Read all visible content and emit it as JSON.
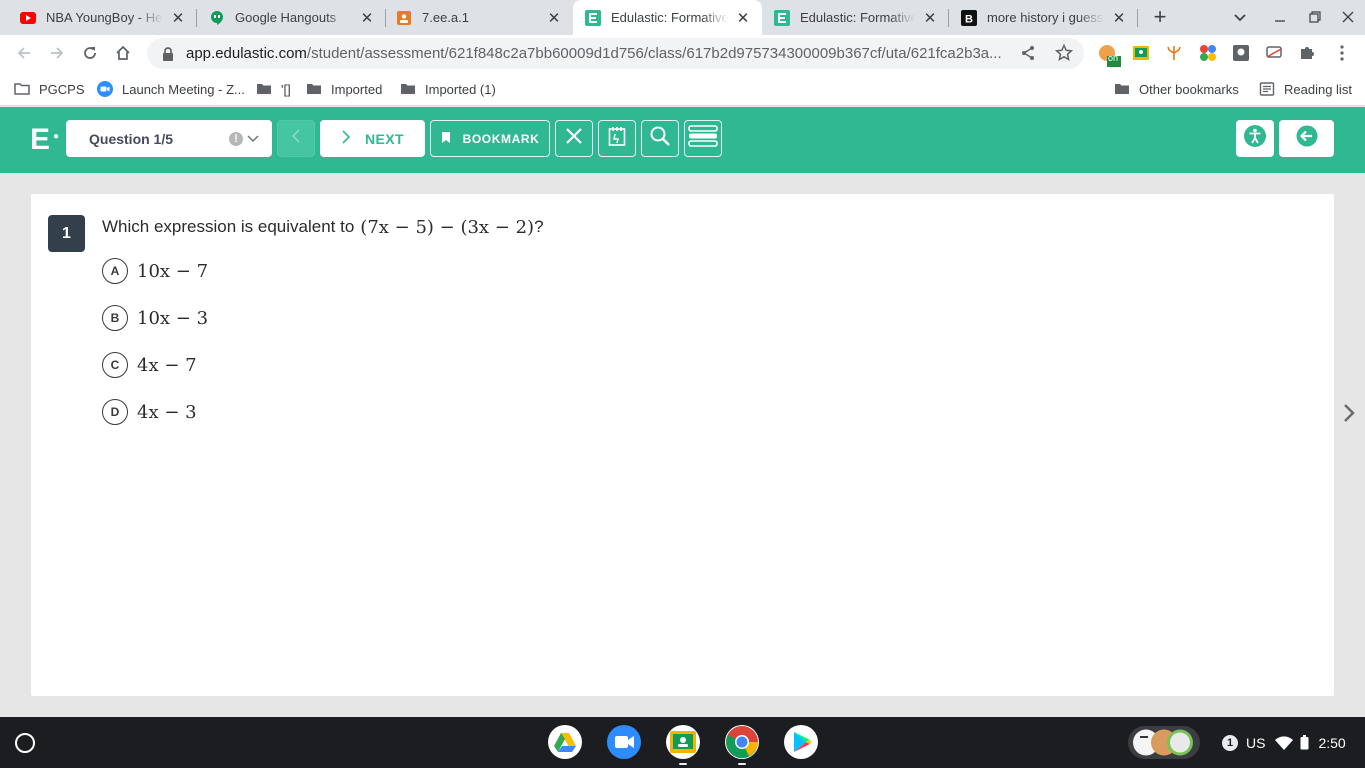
{
  "browser": {
    "tabs": [
      {
        "title": "NBA YoungBoy - Hear",
        "favicon": "youtube-icon",
        "active": false
      },
      {
        "title": "Google Hangouts",
        "favicon": "hangouts-icon",
        "active": false
      },
      {
        "title": "7.ee.a.1",
        "favicon": "slides-icon",
        "active": false
      },
      {
        "title": "Edulastic: Formative a",
        "favicon": "edulastic-icon",
        "active": true
      },
      {
        "title": "Edulastic: Formative a",
        "favicon": "edulastic-icon",
        "active": false
      },
      {
        "title": "more history i guess",
        "favicon": "brainly-icon",
        "active": false
      }
    ],
    "new_tab_symbol": "+",
    "address": {
      "host": "app.edulastic.com",
      "path": "/student/assessment/621f848c2a7bb60009d1d756/class/617b2d975734300009b367cf/uta/621fca2b3a..."
    },
    "extension_badge": "on",
    "bookmarks": [
      "PGCPS",
      "Launch Meeting - Z...",
      "'[]",
      "Imported",
      "Imported (1)"
    ],
    "other_bookmarks": "Other bookmarks",
    "reading_list": "Reading list"
  },
  "edulastic": {
    "logo": "E",
    "question_select": "Question 1/5",
    "warning_symbol": "!",
    "next_label": "NEXT",
    "bookmark_label": "BOOKMARK",
    "brand_color": "#2fb892"
  },
  "question": {
    "number": "1",
    "prompt": "Which expression is equivalent to",
    "expression": "(7x − 5) − (3x − 2)",
    "end_mark": "?",
    "options": [
      {
        "letter": "A",
        "text": "10x − 7"
      },
      {
        "letter": "B",
        "text": "10x − 3"
      },
      {
        "letter": "C",
        "text": "4x − 7"
      },
      {
        "letter": "D",
        "text": "4x − 3"
      }
    ]
  },
  "os": {
    "notification_count": "1",
    "keyboard_layout": "US",
    "time": "2:50"
  }
}
